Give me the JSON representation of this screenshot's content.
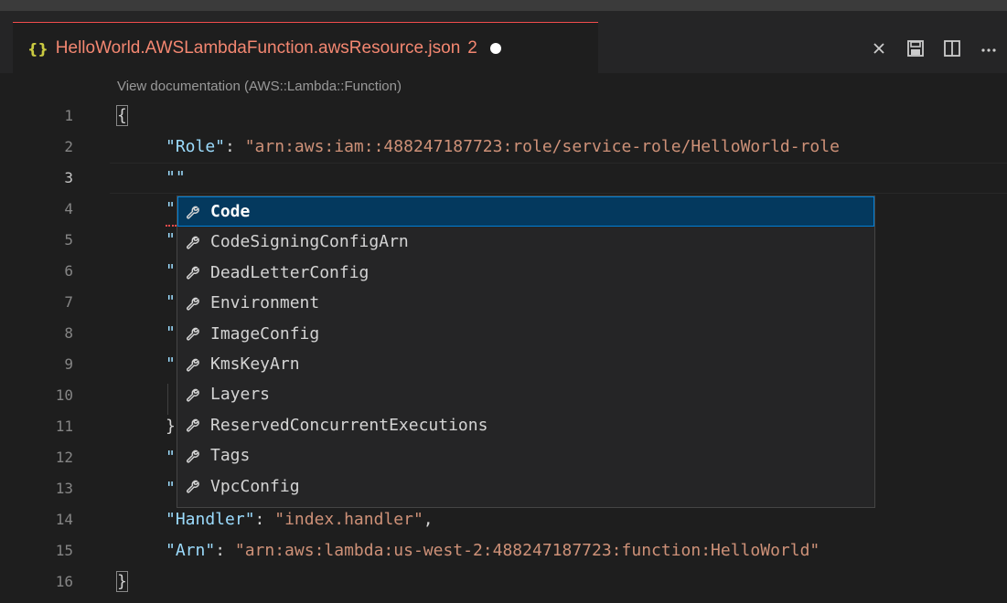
{
  "tab": {
    "icon": "{}",
    "title": "HelloWorld.AWSLambdaFunction.awsResource.json",
    "problem_count": "2",
    "dirty_icon": "dirty-dot-icon",
    "accent_color": "#f48771"
  },
  "actions": [
    {
      "name": "close-icon",
      "glyph": "✕"
    },
    {
      "name": "save-icon",
      "glyph": "💾"
    },
    {
      "name": "split-editor-icon",
      "glyph": "◫"
    },
    {
      "name": "more-actions-icon",
      "glyph": "⋯"
    }
  ],
  "codelens": "View documentation (AWS::Lambda::Function)",
  "line_numbers": [
    "1",
    "2",
    "3",
    "4",
    "5",
    "6",
    "7",
    "8",
    "9",
    "10",
    "11",
    "12",
    "13",
    "14",
    "15",
    "16"
  ],
  "active_line": "3",
  "code": {
    "l1": "{",
    "l2_key": "\"Role\"",
    "l2_colon": ": ",
    "l2_value": "\"arn:aws:iam::488247187723:role/service-role/HelloWorld-role",
    "l3": "\"\"",
    "l4_frag": "\"",
    "l5_frag": "\"",
    "l6_frag": "\"",
    "l7_frag": "\"",
    "l8_frag": "\"",
    "l9_frag": "\"",
    "l11_frag": "}",
    "l12_frag": "\"",
    "l13_frag": "\"",
    "l14_key": "\"Handler\"",
    "l14_colon": ": ",
    "l14_value": "\"index.handler\"",
    "l14_comma": ",",
    "l15_key": "\"Arn\"",
    "l15_colon": ": ",
    "l15_value": "\"arn:aws:lambda:us-west-2:488247187723:function:HelloWorld\"",
    "l16": "}"
  },
  "suggestions": {
    "icon": "wrench-icon",
    "selected_index": 0,
    "items": [
      "Code",
      "CodeSigningConfigArn",
      "DeadLetterConfig",
      "Environment",
      "ImageConfig",
      "KmsKeyArn",
      "Layers",
      "ReservedConcurrentExecutions",
      "Tags",
      "VpcConfig"
    ]
  },
  "colors": {
    "key": "#9cdcfe",
    "string": "#ce9178",
    "selection": "#04395e",
    "error": "#f14c4c"
  }
}
